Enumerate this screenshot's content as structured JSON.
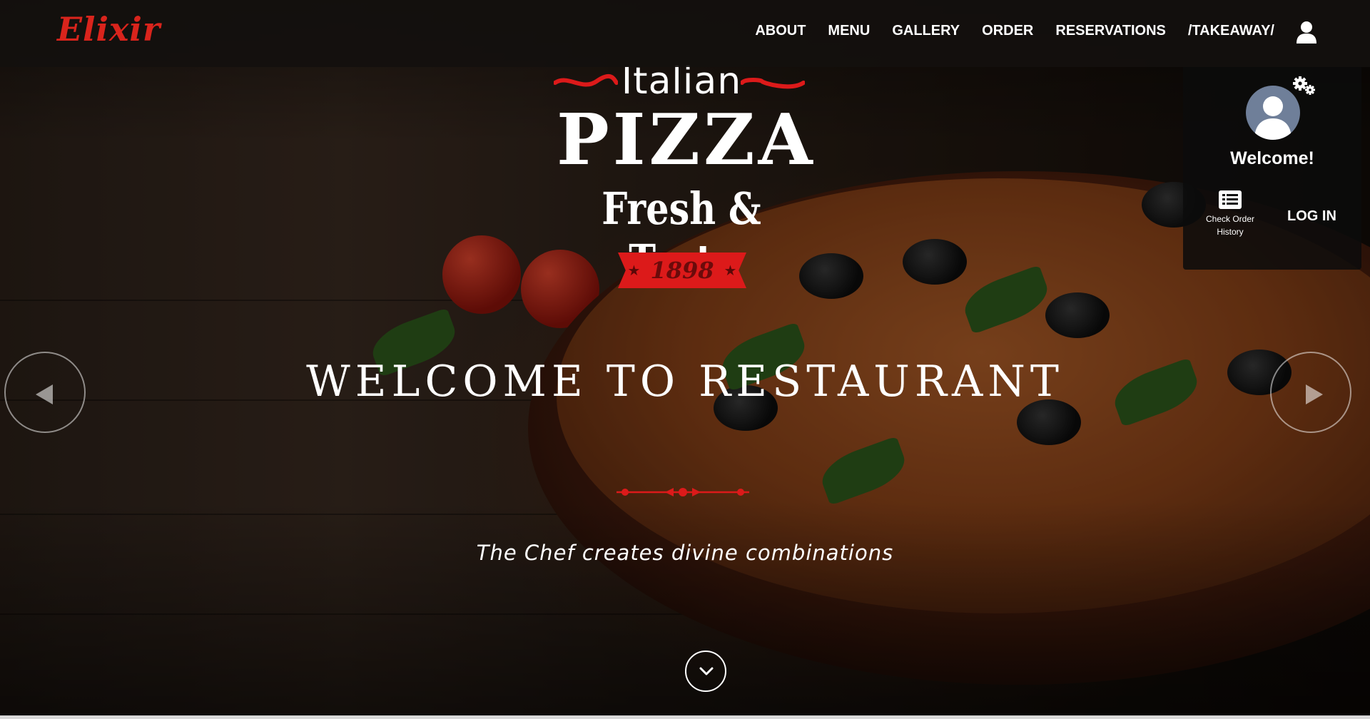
{
  "brand": {
    "name": "Elixir",
    "color": "#d9241c"
  },
  "nav": {
    "links": [
      {
        "label": "ABOUT"
      },
      {
        "label": "MENU"
      },
      {
        "label": "GALLERY"
      },
      {
        "label": "ORDER"
      },
      {
        "label": "RESERVATIONS"
      },
      {
        "label": "/TAKEAWAY/"
      }
    ],
    "user_icon": "user-icon"
  },
  "account_panel": {
    "settings_icon": "gears-icon",
    "avatar_icon": "avatar-silhouette-icon",
    "welcome_text": "Welcome!",
    "order_history": {
      "icon": "list-icon",
      "label": "Check Order\nHistory"
    },
    "login_label": "LOG IN"
  },
  "hero": {
    "logo": {
      "top_word": "Italian",
      "main_word": "PIZZA",
      "sub_line": "Fresh & Tasty",
      "year": "1898",
      "accent_color": "#dc1a1a"
    },
    "title": "WELCOME TO RESTAURANT",
    "tagline": "The Chef creates divine combinations",
    "prev_icon": "triangle-left-icon",
    "next_icon": "triangle-right-icon",
    "scroll_icon": "chevron-down-icon"
  }
}
